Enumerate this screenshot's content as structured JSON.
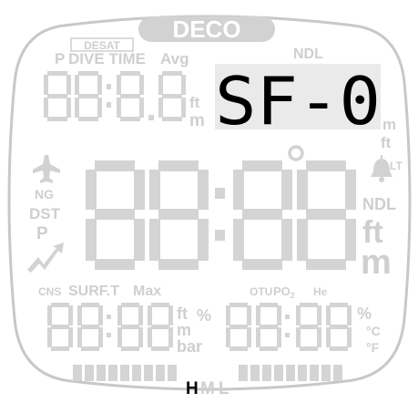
{
  "labels": {
    "deco": "DECO",
    "desat": "DESAT",
    "p_top": "P",
    "dive_time": "DIVE TIME",
    "avg": "Avg",
    "ndl_top": "NDL",
    "ft_tl": "ft",
    "m_tl": "m",
    "m_tr": "m",
    "ft_tr": "ft",
    "ng": "NG",
    "dst": "DST",
    "p_left": "P",
    "lt": "LT",
    "ndl_right": "NDL",
    "ft_main": "ft",
    "m_main": "m",
    "cns": "CNS",
    "surf_t": "SURF.T",
    "max": "Max",
    "ft_bl": "ft",
    "pct_bl": "%",
    "m_bl": "m",
    "bar": "bar",
    "otu": "OTU",
    "po2": "PO",
    "po2_sub": "2",
    "he": "He",
    "pct_br": "%",
    "c_unit": "C",
    "f_unit": "F",
    "h_indicator": "H",
    "m_indicator": "M",
    "l_indicator": "L"
  },
  "display": {
    "active_text": "SF-0",
    "ghost_digits_small": "88:88",
    "ghost_digits_main": "88:88"
  },
  "colors": {
    "active": "#000000",
    "ghost": "#d2d2d2",
    "background": "#ffffff"
  },
  "icons": [
    "plane-icon",
    "bell-icon",
    "trend-icon",
    "degree-icon"
  ]
}
